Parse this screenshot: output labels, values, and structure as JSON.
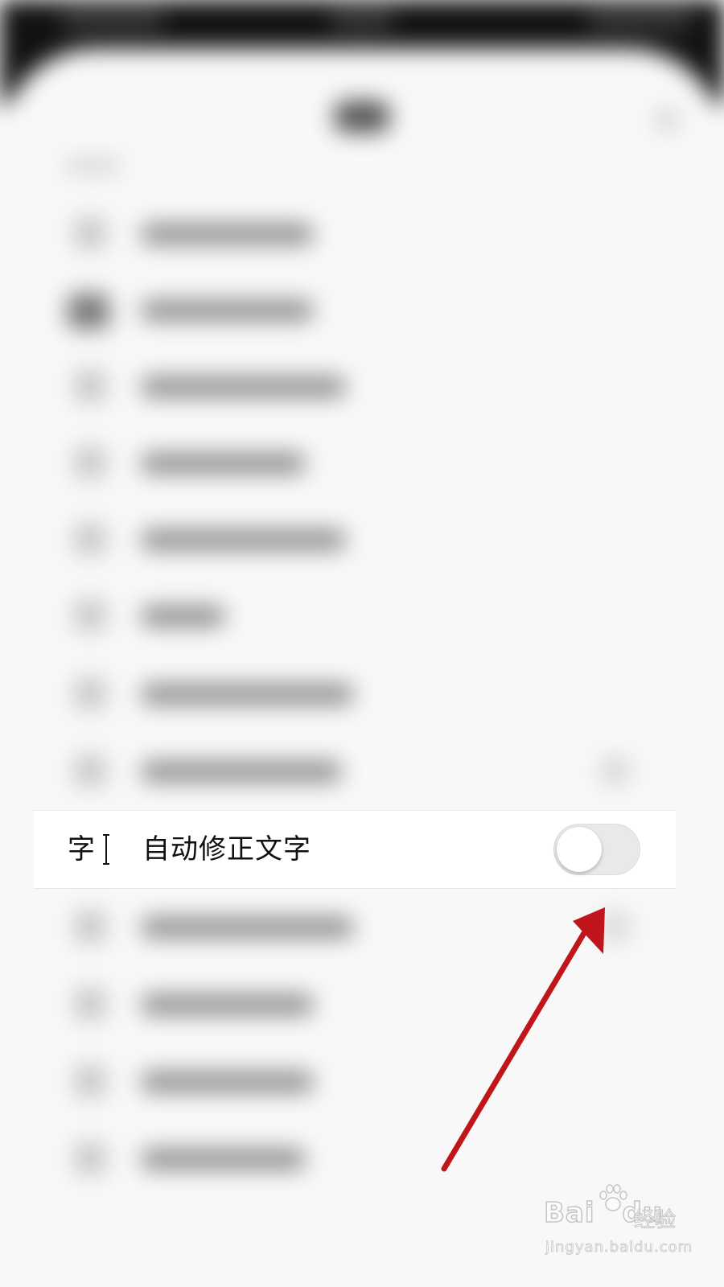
{
  "setting": {
    "label": "自动修正文字",
    "icon_glyph": "字",
    "icon_name": "text-cursor-icon",
    "toggle_state": "off"
  },
  "annotation": {
    "arrow_color": "#c0161b",
    "points_to": "toggle"
  },
  "watermark": {
    "brand": "Bai",
    "brand_suffix": "du",
    "sub": "经验",
    "url": "jingyan.baidu.com"
  },
  "colors": {
    "toggle_off_track": "#e9e9e9",
    "arrow": "#c0161b",
    "background": "#f8f8f8"
  }
}
